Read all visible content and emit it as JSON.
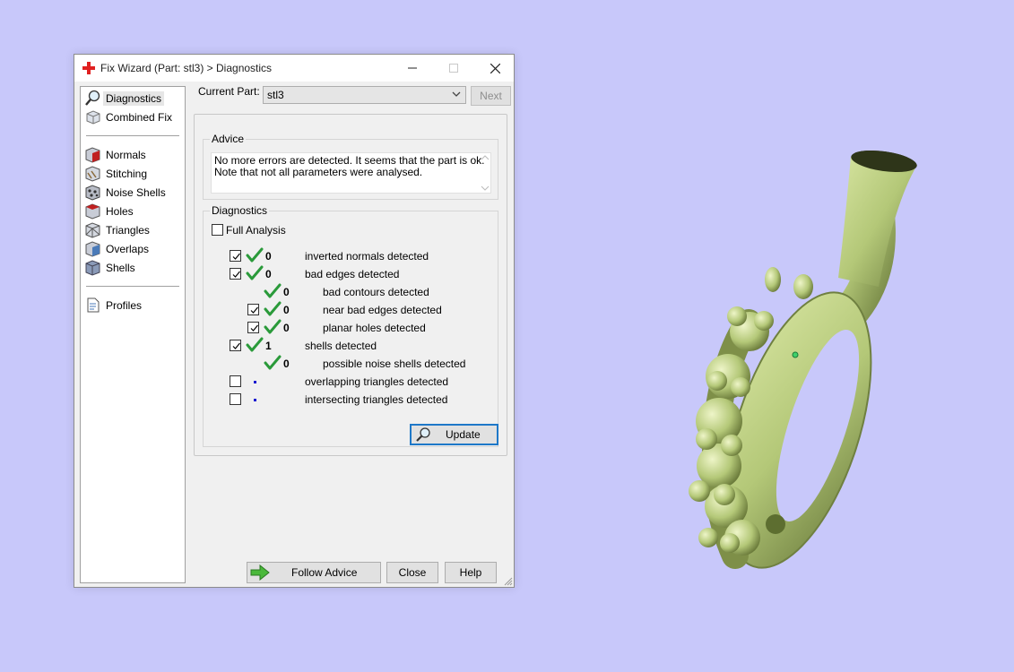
{
  "window": {
    "title": "Fix Wizard (Part: stl3) > Diagnostics"
  },
  "sidebar": {
    "items": [
      {
        "label": "Diagnostics",
        "icon": "magnifier-icon",
        "selected": true
      },
      {
        "label": "Combined Fix",
        "icon": "box-icon"
      },
      {
        "label": "Normals",
        "icon": "normals-icon"
      },
      {
        "label": "Stitching",
        "icon": "stitching-icon"
      },
      {
        "label": "Noise Shells",
        "icon": "noise-shells-icon"
      },
      {
        "label": "Holes",
        "icon": "holes-icon"
      },
      {
        "label": "Triangles",
        "icon": "triangles-icon"
      },
      {
        "label": "Overlaps",
        "icon": "overlaps-icon"
      },
      {
        "label": "Shells",
        "icon": "shells-icon"
      },
      {
        "label": "Profiles",
        "icon": "document-icon"
      }
    ]
  },
  "header": {
    "current_part_label": "Current Part:",
    "current_part_value": "stl3",
    "next_label": "Next"
  },
  "advice": {
    "title": "Advice",
    "line1": "No more errors are detected. It seems that the part is ok.",
    "line2": "Note that not all parameters were analysed."
  },
  "diagnostics": {
    "title": "Diagnostics",
    "full_analysis_label": "Full Analysis",
    "full_analysis_checked": false,
    "rows": [
      {
        "checked": true,
        "status": "ok",
        "count": "0",
        "label": "inverted normals detected"
      },
      {
        "checked": true,
        "status": "ok",
        "count": "0",
        "label": "bad edges detected"
      },
      {
        "status": "ok",
        "count": "0",
        "label": "bad contours detected"
      },
      {
        "checked": true,
        "status": "ok",
        "count": "0",
        "label": "near bad edges detected"
      },
      {
        "checked": true,
        "status": "ok",
        "count": "0",
        "label": "planar holes detected"
      },
      {
        "checked": true,
        "status": "ok",
        "count": "1",
        "label": "shells detected"
      },
      {
        "status": "ok",
        "count": "0",
        "label": "possible noise shells detected"
      },
      {
        "checked": false,
        "status": "pending",
        "count": "",
        "label": "overlapping triangles detected"
      },
      {
        "checked": false,
        "status": "pending",
        "count": "",
        "label": "intersecting triangles detected"
      }
    ],
    "update_label": "Update"
  },
  "footer": {
    "follow_advice_label": "Follow Advice",
    "close_label": "Close",
    "help_label": "Help"
  },
  "colors": {
    "background": "#c8c8fa",
    "model": "#b4c878",
    "check_green": "#2a9a3a",
    "accent_blue": "#1e78c8",
    "close_red": "#e02020"
  }
}
